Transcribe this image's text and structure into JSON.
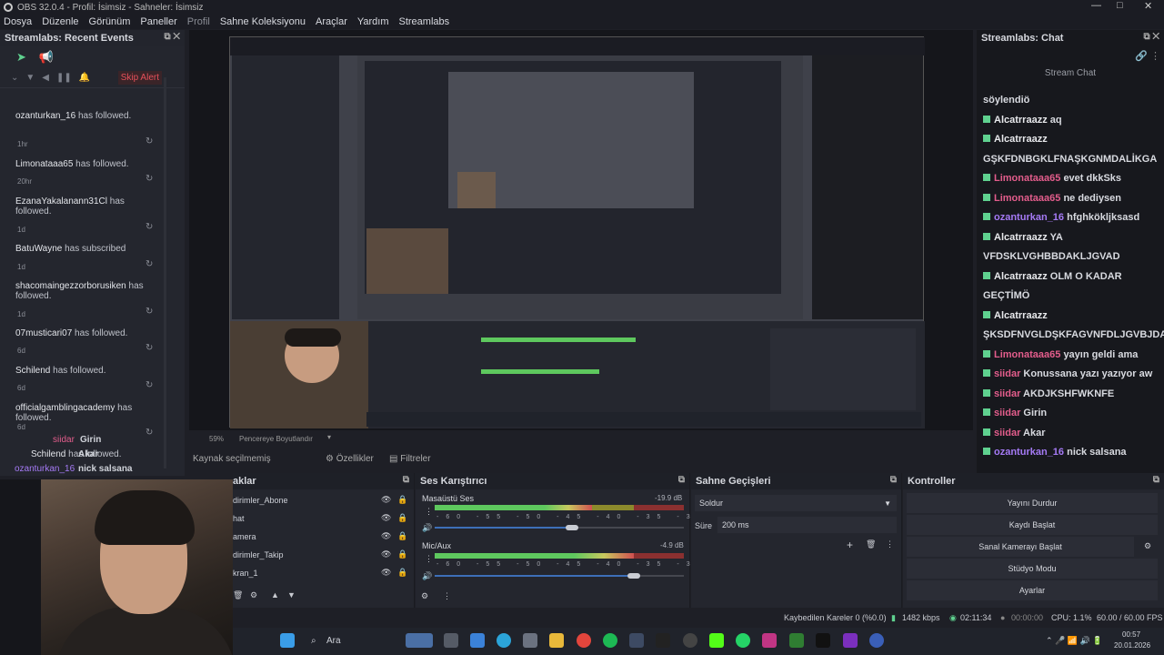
{
  "window": {
    "title": "OBS 32.0.4 - Profil: İsimsiz - Sahneler: İsimsiz",
    "controls": [
      "—",
      "□",
      "✕"
    ]
  },
  "menu": [
    "Dosya",
    "Düzenle",
    "Görünüm",
    "Paneller",
    "Profil",
    "Sahne Koleksiyonu",
    "Araçlar",
    "Yardım",
    "Streamlabs"
  ],
  "events": {
    "title": "Streamlabs: Recent Events",
    "skip_label": "Skip Alert",
    "items": [
      {
        "name": "ozanturkan_16",
        "action": "has followed.",
        "ago": "1hr"
      },
      {
        "name": "Limonataaa65",
        "action": "has followed.",
        "ago": "20hr"
      },
      {
        "name": "EzanaYakalanann31Cl",
        "action": "has followed.",
        "ago": "1d"
      },
      {
        "name": "BatuWayne",
        "action": "has subscribed",
        "ago": "1d"
      },
      {
        "name": "shacomaingezzorborusiken",
        "action": "has followed.",
        "ago": "1d"
      },
      {
        "name": "07musticari07",
        "action": "has followed.",
        "ago": "6d"
      },
      {
        "name": "Schilend",
        "action": "has followed.",
        "ago": "6d"
      },
      {
        "name": "officialgamblingacademy",
        "action": "has followed.",
        "ago": "6d"
      },
      {
        "name": "Schilend",
        "action": "has followed.",
        "ago": ""
      }
    ],
    "overlay_lines": [
      {
        "user": "siidar",
        "msg": "Girin"
      },
      {
        "user": "Schilend",
        "msg": "Akar"
      },
      {
        "user": "ozanturkan_16",
        "msg": "nick salsana"
      }
    ]
  },
  "chat": {
    "title": "Streamlabs: Chat",
    "header": "Stream Chat",
    "lines": [
      {
        "user": "",
        "msg": "söylendiö",
        "color": "n"
      },
      {
        "user": "Alcatrraazz",
        "msg": "aq",
        "color": "n"
      },
      {
        "user": "Alcatrraazz",
        "msg": "",
        "color": "n"
      },
      {
        "user": "",
        "msg": "GŞKFDNBGKLFNAŞKGNMDALİKGA",
        "color": "n"
      },
      {
        "user": "Limonataaa65",
        "msg": "evet dkkSks",
        "color": "r"
      },
      {
        "user": "Limonataaa65",
        "msg": "ne dediysen",
        "color": "r"
      },
      {
        "user": "ozanturkan_16",
        "msg": "hfghkökljksasd",
        "color": "p"
      },
      {
        "user": "Alcatrraazz",
        "msg": "YA",
        "color": "n"
      },
      {
        "user": "",
        "msg": "VFDSKLVGHBBDAKLJGVAD",
        "color": "n"
      },
      {
        "user": "Alcatrraazz",
        "msg": "OLM O KADAR",
        "color": "n"
      },
      {
        "user": "",
        "msg": "GEÇTİMÖ",
        "color": "n"
      },
      {
        "user": "Alcatrraazz",
        "msg": "",
        "color": "n"
      },
      {
        "user": "",
        "msg": "ŞKSDFNVGLDŞKFAGVNFDLJGVBJDAŞ",
        "color": "n"
      },
      {
        "user": "Limonataaa65",
        "msg": "yayın geldi ama",
        "color": "r"
      },
      {
        "user": "siidar",
        "msg": "Konussana yazı yazıyor aw",
        "color": "r"
      },
      {
        "user": "siidar",
        "msg": "AKDJKSHFWKNFE",
        "color": "r"
      },
      {
        "user": "siidar",
        "msg": "Girin",
        "color": "r"
      },
      {
        "user": "siidar",
        "msg": "Akar",
        "color": "r"
      },
      {
        "user": "ozanturkan_16",
        "msg": "nick salsana",
        "color": "p"
      }
    ]
  },
  "zoom": {
    "value": "59%",
    "label": "Pencereye Boyutlandır"
  },
  "source_bar": {
    "selected": "Kaynak seçilmemiş",
    "props": "Özellikler",
    "filters": "Filtreler"
  },
  "sources": {
    "title": "aklar",
    "items": [
      "dirimler_Abone",
      "hat",
      "amera",
      "dirimler_Takip",
      "kran_1"
    ]
  },
  "mixer": {
    "title": "Ses Karıştırıcı",
    "channels": [
      {
        "name": "Masaüstü Ses",
        "db": "-19.9 dB",
        "level": 0.63,
        "volume": 0.55
      },
      {
        "name": "Mic/Aux",
        "db": "-4.9 dB",
        "level": 0.8,
        "volume": 0.8
      }
    ],
    "ticks": "-60 -55 -50 -45 -40 -35 -30 -25 -20 -15 -10 -5 0"
  },
  "transitions": {
    "title": "Sahne Geçişleri",
    "type": "Soldur",
    "duration_label": "Süre",
    "duration": "200 ms"
  },
  "controls": {
    "title": "Kontroller",
    "buttons": [
      "Yayını Durdur",
      "Kaydı Başlat",
      "Sanal Kamerayı Başlat",
      "Stüdyo Modu",
      "Ayarlar"
    ]
  },
  "status": {
    "dropped": "Kaybedilen Kareler 0 (%0.0)",
    "bitrate": "1482 kbps",
    "stream_time": "02:11:34",
    "rec_time": "00:00:00",
    "cpu": "CPU: 1.1%",
    "fps": "60.00 / 60.00 FPS"
  },
  "taskbar": {
    "search": "Ara",
    "time": "00:57",
    "date": "20.01.2026"
  },
  "colors": {
    "accent": "#5fd18f",
    "red_user": "#e35d8c",
    "purple_user": "#a57af5",
    "skip": "#e6505a"
  }
}
